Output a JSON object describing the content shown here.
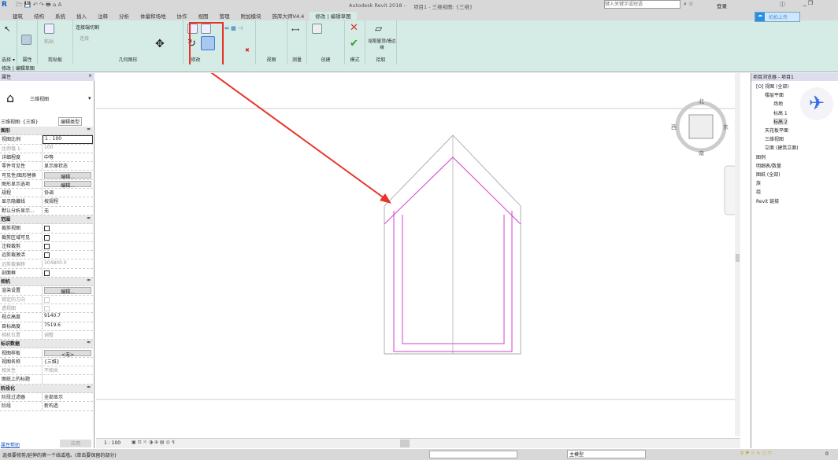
{
  "title": {
    "app": "Autodesk Revit 2018 -",
    "doc": "项目1 - 三维视图: {三维}",
    "search_placeholder": "键入关键字或短语",
    "login": "登录",
    "upload": "拍拍上传"
  },
  "tabs": [
    "建筑",
    "结构",
    "系统",
    "插入",
    "注释",
    "分析",
    "体量和场地",
    "协作",
    "视图",
    "管理",
    "附加模块",
    "族库大师V4.4",
    "修改 | 编辑草图"
  ],
  "ribbon": {
    "panels": [
      "选择 ▾",
      "属性",
      "剪贴板",
      "几何图形",
      "修改",
      "视图",
      "测量",
      "创建",
      "模式",
      "拾取"
    ],
    "modify_label": "修改",
    "paste": "粘贴",
    "cut_join": "连接端切割",
    "join": "连接",
    "pick": "拾取屋顶/墙边缘"
  },
  "context": "修改 | 编辑草图",
  "properties": {
    "title": "属性",
    "type_name": "三维视图",
    "selector": "三维视图: {三维}",
    "edit_type": "编辑类型",
    "rows": [
      {
        "g": "图形"
      },
      {
        "k": "视图比例",
        "v": "1 : 100"
      },
      {
        "k": "比例值 1:",
        "v": "100",
        "dim": true
      },
      {
        "k": "详细程度",
        "v": "中等"
      },
      {
        "k": "零件可见性",
        "v": "显示原状态"
      },
      {
        "k": "可见性/图形替换",
        "b": "编辑..."
      },
      {
        "k": "图形显示选项",
        "b": "编辑..."
      },
      {
        "k": "规程",
        "v": "协调"
      },
      {
        "k": "显示隐藏线",
        "v": "按规程"
      },
      {
        "k": "默认分析显示...",
        "v": "无"
      },
      {
        "g": "范围"
      },
      {
        "k": "裁剪视图",
        "c": true
      },
      {
        "k": "裁剪区域可见",
        "c": true
      },
      {
        "k": "注释裁剪",
        "c": true
      },
      {
        "k": "远剪裁激活",
        "c": true
      },
      {
        "k": "远剪裁偏移",
        "v": "304800.0",
        "dim": true
      },
      {
        "k": "剖面框",
        "c": true
      },
      {
        "g": "相机"
      },
      {
        "k": "渲染设置",
        "b": "编辑..."
      },
      {
        "k": "锁定的方向",
        "dim": true
      },
      {
        "k": "透视图",
        "dim": true
      },
      {
        "k": "视点高度",
        "v": "9140.7"
      },
      {
        "k": "目标高度",
        "v": "7519.6"
      },
      {
        "k": "相机位置",
        "v": "调整",
        "dim": true
      },
      {
        "g": "标识数据"
      },
      {
        "k": "视图样板",
        "b": "<无>"
      },
      {
        "k": "视图名称",
        "v": "{三维}"
      },
      {
        "k": "相关性",
        "v": "不相关",
        "dim": true
      },
      {
        "k": "图纸上的标题",
        "v": ""
      },
      {
        "g": "阶段化"
      },
      {
        "k": "阶段过滤器",
        "v": "全部显示"
      },
      {
        "k": "阶段",
        "v": "新构造"
      }
    ],
    "help": "属性帮助",
    "apply": "应用"
  },
  "browser": {
    "title": "项目浏览器 - 项目1",
    "items": [
      {
        "t": "[O] 视图 (全部)",
        "l": 0
      },
      {
        "t": "楼层平面",
        "l": 1
      },
      {
        "t": "场地",
        "l": 2
      },
      {
        "t": "标高 1",
        "l": 2
      },
      {
        "t": "标高 2",
        "l": 2,
        "sel": true
      },
      {
        "t": "天花板平面",
        "l": 1
      },
      {
        "t": "三维视图",
        "l": 1
      },
      {
        "t": "立面 (建筑立面)",
        "l": 1
      },
      {
        "t": "图例",
        "l": 0
      },
      {
        "t": "明细表/数量",
        "l": 0
      },
      {
        "t": "图纸 (全部)",
        "l": 0
      },
      {
        "t": "族",
        "l": 0
      },
      {
        "t": "组",
        "l": 0
      },
      {
        "t": "Revit 链接",
        "l": 0
      }
    ]
  },
  "viewcube": {
    "n": "北",
    "s": "南",
    "e": "东",
    "w": "西"
  },
  "viewbar": {
    "scale": "1 : 100"
  },
  "status": {
    "text": "选择要修剪/延伸的第一个线或墙。(单击要保留的部分)",
    "model": "主模型",
    "filter": "0"
  },
  "colors": {
    "ribbon": "#d4ebe6",
    "sketch": "#d040d0",
    "arrow": "#e8332a"
  }
}
